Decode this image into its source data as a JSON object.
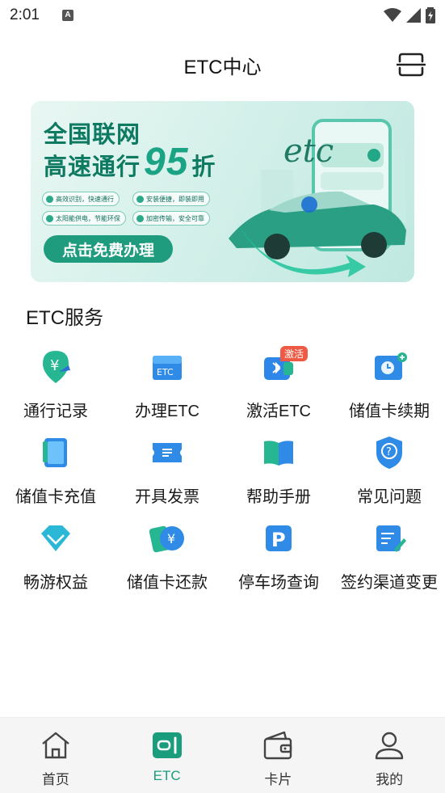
{
  "status_bar": {
    "time": "2:01"
  },
  "header": {
    "title": "ETC中心"
  },
  "banner": {
    "title_line1": "全国联网",
    "title_line2_prefix": "高速通行",
    "discount": "95",
    "discount_suffix": "折",
    "features": [
      "高效识别，快速通行",
      "安装便捷，即装即用",
      "太阳能供电，节能环保",
      "加密传输，安全可靠"
    ],
    "cta": "点击免费办理",
    "art_text": "etc"
  },
  "services": {
    "title": "ETC服务",
    "items": [
      {
        "label": "通行记录",
        "icon": "yen-pass-record-icon"
      },
      {
        "label": "办理ETC",
        "icon": "etc-card-icon"
      },
      {
        "label": "激活ETC",
        "icon": "bluetooth-activate-icon",
        "badge": "激活"
      },
      {
        "label": "储值卡续期",
        "icon": "calendar-clock-icon"
      },
      {
        "label": "储值卡充值",
        "icon": "recharge-card-icon"
      },
      {
        "label": "开具发票",
        "icon": "invoice-ticket-icon"
      },
      {
        "label": "帮助手册",
        "icon": "book-icon"
      },
      {
        "label": "常见问题",
        "icon": "question-shield-icon"
      },
      {
        "label": "畅游权益",
        "icon": "diamond-icon"
      },
      {
        "label": "储值卡还款",
        "icon": "yen-card-repay-icon"
      },
      {
        "label": "停车场查询",
        "icon": "parking-icon"
      },
      {
        "label": "签约渠道变更",
        "icon": "edit-document-icon"
      }
    ]
  },
  "tabbar": {
    "tabs": [
      {
        "label": "首页",
        "icon": "home-icon"
      },
      {
        "label": "ETC",
        "icon": "etc-icon",
        "active": true
      },
      {
        "label": "卡片",
        "icon": "wallet-icon"
      },
      {
        "label": "我的",
        "icon": "user-icon"
      }
    ]
  },
  "colors": {
    "accent": "#1a9d7d",
    "badge": "#ee5a43"
  }
}
